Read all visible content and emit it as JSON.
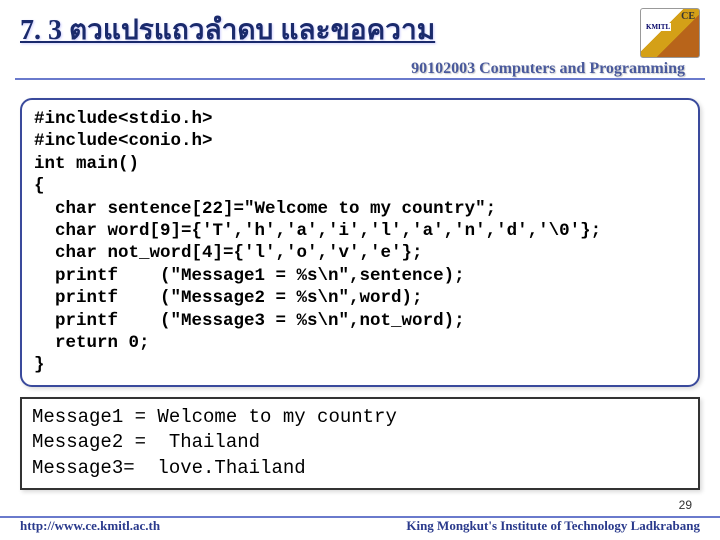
{
  "header": {
    "title": "7. 3 ตวแปรแถวลำดบ  และขอความ",
    "subtitle": "90102003 Computers and Programming"
  },
  "code": "#include<stdio.h>\n#include<conio.h>\nint main()\n{\n  char sentence[22]=\"Welcome to my country\";\n  char word[9]={'T','h','a','i','l','a','n','d','\\0'};\n  char not_word[4]={'l','o','v','e'};\n  printf    (\"Message1 = %s\\n\",sentence);\n  printf    (\"Message2 = %s\\n\",word);\n  printf    (\"Message3 = %s\\n\",not_word);\n  return 0;\n}",
  "output": "Message1 = Welcome to my country\nMessage2 =  Thailand\nMessage3=  love.Thailand",
  "footer": {
    "left": "http://www.ce.kmitl.ac.th",
    "right": "King Mongkut's Institute of Technology Ladkrabang"
  },
  "page": "29"
}
